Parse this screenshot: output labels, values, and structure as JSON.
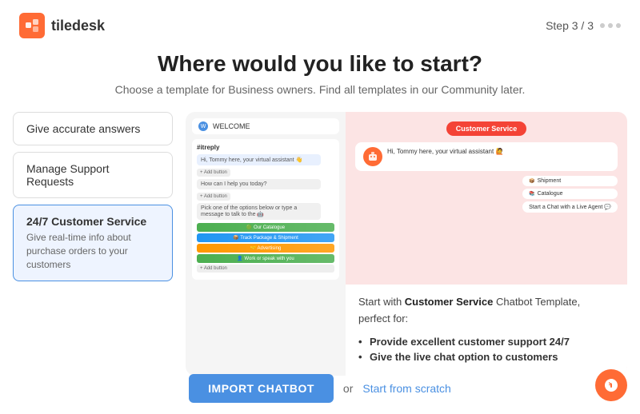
{
  "header": {
    "logo_text": "tiledesk",
    "step_label": "Step  3 / 3"
  },
  "page": {
    "title": "Where would you like to start?",
    "subtitle": "Choose a template for Business owners. Find all templates in our Community later."
  },
  "templates": [
    {
      "id": "accurate-answers",
      "label": "Give accurate answers",
      "active": false
    },
    {
      "id": "manage-support",
      "label": "Manage Support Requests",
      "active": false
    },
    {
      "id": "customer-service",
      "title": "24/7 Customer Service",
      "desc": "Give real-time info about purchase orders to your customers",
      "active": true
    }
  ],
  "preview": {
    "header": "WELCOME",
    "chat_title": "#itreply",
    "greeting": "Hi, Tommy here, your virtual assistant 👋",
    "question": "How can I help you today?",
    "options_prompt": "Pick one of the options below or type a message to talk to the 🤖",
    "option1": "🟢 Our Catalogue",
    "option2": "📦 Track Package & Shipment",
    "option3": "🤝 Advertising",
    "option4": "👤 Work or speak with you",
    "badge": "Customer Service",
    "bot_greeting": "Hi, Tommy here, your virtual assistant 🙋",
    "qr1": "Shipment",
    "qr2": "Catalogue",
    "qr3": "Start a Chat with a Live Agent 💬"
  },
  "description": {
    "text_prefix": "Start with ",
    "bold_name": "Customer Service",
    "text_suffix": " Chatbot Template, perfect for:",
    "bullets": [
      "Provide excellent customer support 24/7",
      "Give the live chat option to customers"
    ]
  },
  "footer": {
    "import_label": "IMPORT CHATBOT",
    "or_label": "or",
    "scratch_label": "Start from scratch"
  }
}
